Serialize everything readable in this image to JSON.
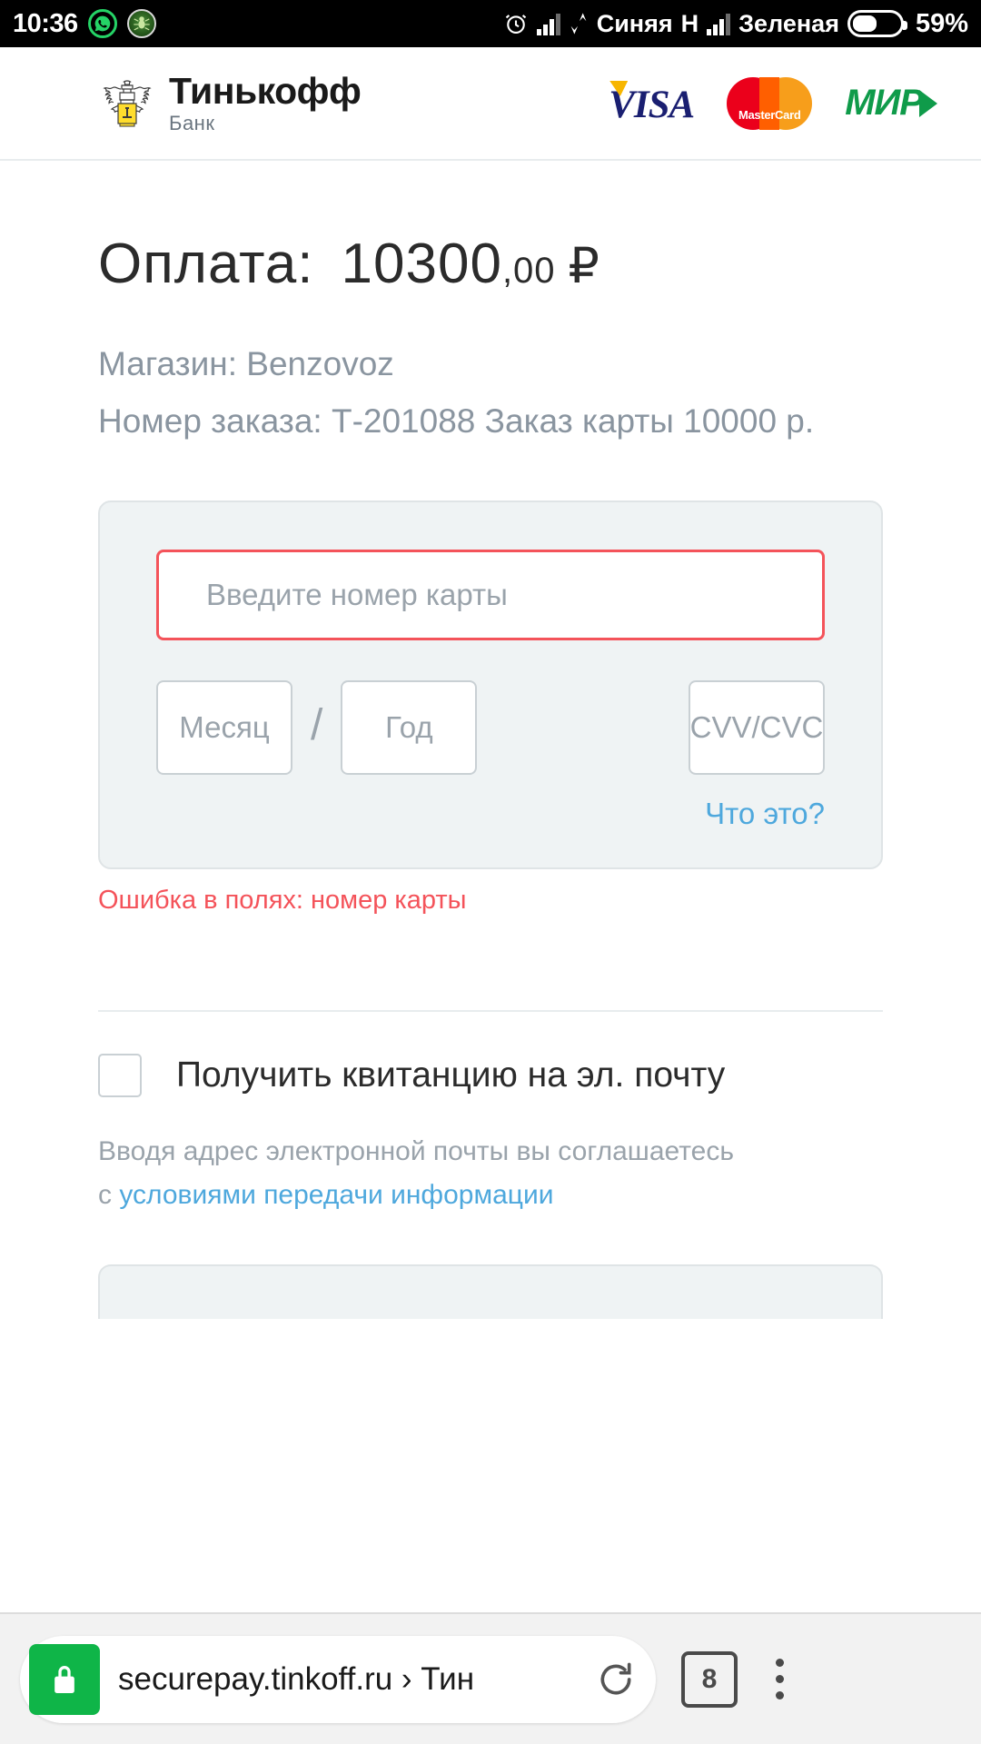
{
  "status_bar": {
    "time": "10:36",
    "icons": [
      "whatsapp-icon",
      "drweb-icon",
      "alarm-icon",
      "sync-icon"
    ],
    "sim1_label": "Синяя",
    "sim1_network": "H",
    "sim2_label": "Зеленая",
    "battery_percent": "59%",
    "background_color": "#000000"
  },
  "page_header": {
    "brand_name": "Тинькофф",
    "brand_sub": "Банк",
    "payment_systems": [
      {
        "name": "VISA",
        "label": "VISA"
      },
      {
        "name": "MasterCard",
        "label": "MasterCard"
      },
      {
        "name": "MIR",
        "label": "МИР"
      }
    ]
  },
  "payment": {
    "amount_label": "Оплата:",
    "amount_integer": "10300",
    "amount_fraction": ",00",
    "currency": "₽",
    "shop_line": "Магазин: Benzovoz",
    "order_line": "Номер заказа: Т-201088 Заказ карты 10000 р."
  },
  "card_form": {
    "card_number_placeholder": "Введите номер карты",
    "card_number_value": "",
    "month_placeholder": "Месяц",
    "month_value": "",
    "separator": "/",
    "year_placeholder": "Год",
    "year_value": "",
    "cvv_placeholder": "CVV/CVC",
    "cvv_value": "",
    "what_is_this_link": "Что это?",
    "error_message": "Ошибка в полях: номер карты",
    "error_color": "#f4535a",
    "link_color": "#4ea8dd",
    "panel_background": "#eff3f4"
  },
  "receipt": {
    "checkbox_label": "Получить квитанцию на эл. почту",
    "checked": false,
    "consent_prefix": "Вводя адрес электронной почты вы соглашаетесь",
    "consent_second_prefix": "с ",
    "consent_link": "условиями передачи информации"
  },
  "browser_bar": {
    "lock_icon": "lock-icon",
    "url_text": "securepay.tinkoff.ru › Тин",
    "reload_icon": "reload-icon",
    "tab_count": "8",
    "menu_icon": "overflow-menu-icon",
    "background_color": "#f2f2f2",
    "lock_color": "#0fb548"
  }
}
